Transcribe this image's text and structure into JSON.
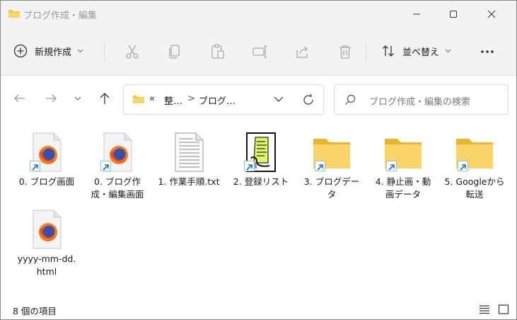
{
  "window": {
    "title": "ブログ作成・編集"
  },
  "toolbar": {
    "new_label": "新規作成",
    "sort_label": "並べ替え",
    "icons": [
      "cut-icon",
      "copy-icon",
      "paste-icon",
      "rename-icon",
      "share-icon",
      "delete-icon"
    ]
  },
  "address": {
    "overflow": "«",
    "crumbs": [
      "整…",
      "ブログ…"
    ],
    "separator": ">"
  },
  "search": {
    "placeholder": "ブログ作成・編集の検索"
  },
  "files": [
    {
      "label": "0. ブログ画面",
      "icon": "firefox-html-icon",
      "shortcut": true
    },
    {
      "label": "0. ブログ作成・編集画面",
      "icon": "firefox-html-icon",
      "shortcut": true
    },
    {
      "label": "1. 作業手順.txt",
      "icon": "text-file-icon",
      "shortcut": false
    },
    {
      "label": "2. 登録リスト",
      "icon": "scroll-file-icon",
      "shortcut": true
    },
    {
      "label": "3. ブログデータ",
      "icon": "folder-icon",
      "shortcut": true
    },
    {
      "label": "4. 静止画・動画データ",
      "icon": "folder-icon",
      "shortcut": true
    },
    {
      "label": "5. Googleから転送",
      "icon": "folder-icon",
      "shortcut": true
    },
    {
      "label": "yyyy-mm-dd.html",
      "icon": "firefox-html-icon",
      "shortcut": false
    }
  ],
  "status": {
    "count_text": "8 個の項目"
  },
  "colors": {
    "folder": "#f4c542",
    "accent": "#0067c0",
    "chrome": "#f3f3f3"
  }
}
